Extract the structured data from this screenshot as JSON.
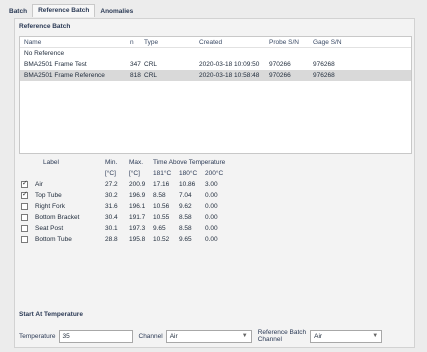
{
  "tabs": [
    "Batch",
    "Reference Batch",
    "Anomalies"
  ],
  "reference_batch_label": "Reference Batch",
  "batch_list": {
    "headers": {
      "name": "Name",
      "n": "n",
      "type": "Type",
      "created": "Created",
      "probe_sn": "Probe S/N",
      "gage_sn": "Gage S/N"
    },
    "rows": [
      {
        "name": "No Reference",
        "n": "",
        "type": "",
        "created": "",
        "probe_sn": "",
        "gage_sn": ""
      },
      {
        "name": "BMA2501 Frame Test",
        "n": "347",
        "type": "CRL",
        "created": "2020-03-18 10:09:50",
        "probe_sn": "970266",
        "gage_sn": "976268"
      },
      {
        "name": "BMA2501 Frame Reference",
        "n": "818",
        "type": "CRL",
        "created": "2020-03-18 10:58:48",
        "probe_sn": "970266",
        "gage_sn": "976268"
      }
    ]
  },
  "temps": {
    "headers": {
      "label": "Label",
      "min": "Min.",
      "max": "Max.",
      "time_above": "Time Above Temperature"
    },
    "units": {
      "min": "[°C]",
      "max": "[°C]",
      "t1": "181°C",
      "t2": "180°C",
      "t3": "200°C"
    },
    "rows": [
      {
        "checked": true,
        "label": "Air",
        "min": "27.2",
        "max": "200.9",
        "t1": "17.16",
        "t2": "10.86",
        "t3": "3.00"
      },
      {
        "checked": true,
        "label": "Top Tube",
        "min": "30.2",
        "max": "196.9",
        "t1": "8.58",
        "t2": "7.04",
        "t3": "0.00"
      },
      {
        "checked": false,
        "label": "Right Fork",
        "min": "31.6",
        "max": "196.1",
        "t1": "10.56",
        "t2": "9.62",
        "t3": "0.00"
      },
      {
        "checked": false,
        "label": "Bottom Bracket",
        "min": "30.4",
        "max": "191.7",
        "t1": "10.55",
        "t2": "8.58",
        "t3": "0.00"
      },
      {
        "checked": false,
        "label": "Seat Post",
        "min": "30.1",
        "max": "197.3",
        "t1": "9.65",
        "t2": "8.58",
        "t3": "0.00"
      },
      {
        "checked": false,
        "label": "Bottom Tube",
        "min": "28.8",
        "max": "195.8",
        "t1": "10.52",
        "t2": "9.65",
        "t3": "0.00"
      }
    ]
  },
  "start_at_temp_label": "Start At Temperature",
  "temperature": {
    "label": "Temperature",
    "value": "35"
  },
  "channel": {
    "label": "Channel",
    "value": "Air"
  },
  "ref_channel": {
    "label_line1": "Reference Batch",
    "label_line2": "Channel",
    "value": "Air"
  }
}
